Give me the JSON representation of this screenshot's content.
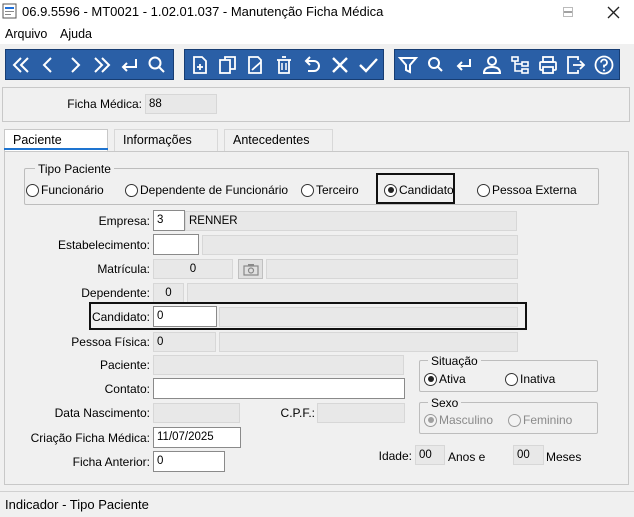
{
  "window": {
    "title": "06.9.5596 - MT0021 - 1.02.01.037 - Manutenção Ficha Médica"
  },
  "menu": {
    "arquivo": "Arquivo",
    "ajuda": "Ajuda"
  },
  "header": {
    "ficha_label": "Ficha Médica:",
    "ficha_value": "88"
  },
  "tabs": [
    "Paciente",
    "Informações",
    "Antecedentes"
  ],
  "tipo_paciente": {
    "title": "Tipo Paciente",
    "options": [
      "Funcionário",
      "Dependente de Funcionário",
      "Terceiro",
      "Candidato",
      "Pessoa Externa"
    ],
    "selected": "Candidato"
  },
  "fields": {
    "empresa_label": "Empresa:",
    "empresa_code": "3",
    "empresa_name": "RENNER",
    "estabelecimento_label": "Estabelecimento:",
    "estabelecimento_code": "",
    "estabelecimento_name": "",
    "matricula_label": "Matrícula:",
    "matricula_value": "0",
    "matricula_name": "",
    "dependente_label": "Dependente:",
    "dependente_value": "0",
    "dependente_name": "",
    "candidato_label": "Candidato:",
    "candidato_value": "0",
    "candidato_name": "",
    "pessoa_fisica_label": "Pessoa Física:",
    "pessoa_fisica_value": "0",
    "pessoa_fisica_name": "",
    "paciente_label": "Paciente:",
    "paciente_value": "",
    "contato_label": "Contato:",
    "contato_value": "",
    "data_nascimento_label": "Data Nascimento:",
    "data_nascimento_value": "",
    "cpf_label": "C.P.F.:",
    "cpf_value": "",
    "criacao_label": "Criação Ficha Médica:",
    "criacao_value": "11/07/2025",
    "ficha_anterior_label": "Ficha Anterior:",
    "ficha_anterior_value": "0",
    "idade_label": "Idade:",
    "idade_anos": "00",
    "anos_label": "Anos e",
    "idade_meses": "00",
    "meses_label": "Meses"
  },
  "situacao": {
    "title": "Situação",
    "ativa": "Ativa",
    "inativa": "Inativa",
    "selected": "Ativa"
  },
  "sexo": {
    "title": "Sexo",
    "masculino": "Masculino",
    "feminino": "Feminino",
    "selected": "Masculino"
  },
  "status_bar": {
    "text": "Indicador - Tipo Paciente"
  },
  "icons": {
    "toolbar_nav": [
      "first-icon",
      "previous-icon",
      "next-icon",
      "last-icon",
      "goto-icon",
      "search-icon"
    ],
    "toolbar_edit": [
      "add-icon",
      "copy-icon",
      "edit-icon",
      "delete-icon",
      "undo-icon",
      "cancel-icon",
      "save-icon"
    ],
    "toolbar_misc": [
      "filter-icon",
      "query-icon",
      "return-icon",
      "user-icon",
      "structure-icon",
      "print-icon",
      "exit-icon",
      "help-icon"
    ]
  },
  "colors": {
    "toolbar_bg": "#2a5fa6",
    "tab_accent": "#1e74d0",
    "window_bg": "#f0f0f0"
  }
}
